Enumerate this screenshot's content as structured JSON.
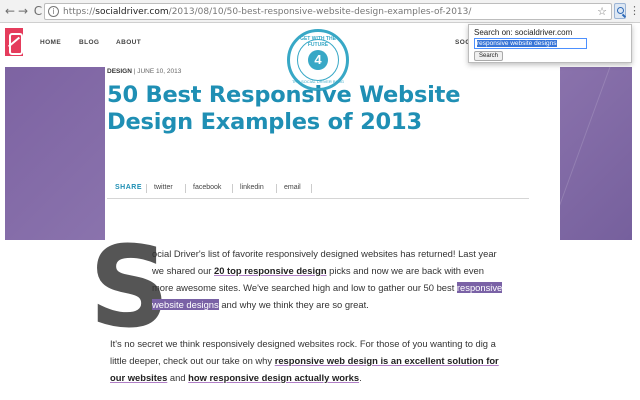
{
  "browser": {
    "url_prefix": "https://",
    "url_host": "socialdriver.com",
    "url_path": "/2013/08/10/50-best-responsive-website-design-examples-of-2013/",
    "back_glyph": "←",
    "forward_glyph": "→",
    "reload_glyph": "C",
    "info_glyph": "i",
    "star_glyph": "☆",
    "menu_glyph": "⋮"
  },
  "site_nav": {
    "home": "HOME",
    "blog": "BLOG",
    "about": "ABOUT",
    "soc": "SOC"
  },
  "badge": {
    "top_text": "GET WITH THE FUTURE",
    "core": "4",
    "bottom_text": "THE SOCIAL DRIVER BLOG"
  },
  "article": {
    "category": "DESIGN",
    "date": " | JUNE 10, 2013",
    "title": "50 Best Responsive Website Design Examples of 2013",
    "share": {
      "label": "SHARE",
      "twitter": "twitter",
      "facebook": "facebook",
      "linkedin": "linkedin",
      "email": "email"
    },
    "dropcap": "S",
    "p1": {
      "l1": "ocial Driver's list of favorite responsively designed websites has returned! Last year",
      "l2a": "we shared our ",
      "l2link": "20 top responsive design",
      "l2b": " picks and now we are back with even",
      "l3a": "more awesome sites. We've searched high and low to gather our 50 best ",
      "l3hl": "responsive",
      "l4hl": "website designs",
      "l4b": " and why we think they are so great."
    },
    "p2": {
      "l1": "It's no secret we think responsively designed websites rock. For those of you wanting to dig a",
      "l2a": "little deeper, check out our take on why ",
      "l2link": "responsive web design is an excellent solution for",
      "l3link": "our websites",
      "l3b": " and ",
      "l3link2": "how responsive design actually works",
      "l3c": "."
    }
  },
  "search_popup": {
    "label": "Search on: socialdriver.com",
    "input_value": "responsive website designs",
    "button": "Search"
  },
  "colors": {
    "title_blue": "#1f8fb4",
    "band_purple": "#7e65a3",
    "highlight_purple": "#7a62a6",
    "logo_red": "#e53c5c"
  }
}
